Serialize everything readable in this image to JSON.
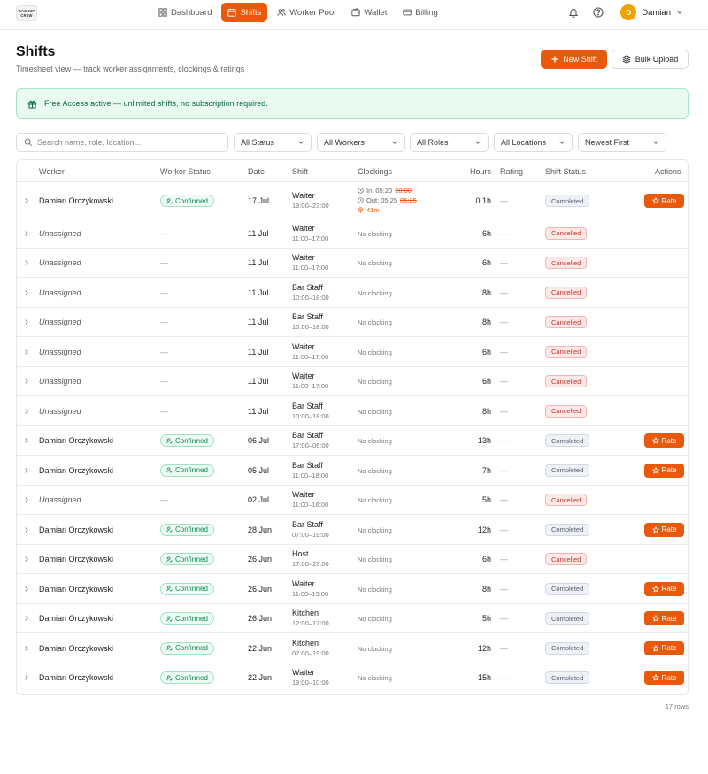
{
  "brand": {
    "logo_line1": "BACKUP",
    "logo_line2": "CREW"
  },
  "nav": {
    "items": [
      {
        "label": "Dashboard",
        "icon": "dashboard-icon",
        "active": false
      },
      {
        "label": "Shifts",
        "icon": "calendar-icon",
        "active": true
      },
      {
        "label": "Worker Pool",
        "icon": "users-icon",
        "active": false
      },
      {
        "label": "Wallet",
        "icon": "wallet-icon",
        "active": false
      },
      {
        "label": "Billing",
        "icon": "card-icon",
        "active": false
      }
    ],
    "user": {
      "initial": "D",
      "name": "Damian"
    }
  },
  "header": {
    "title": "Shifts",
    "subtitle": "Timesheet view — track worker assignments, clockings & ratings",
    "new_shift": "New Shift",
    "bulk_upload": "Bulk Upload"
  },
  "banner": {
    "text": "Free Access active — unlimited shifts, no subscription required."
  },
  "filters": {
    "search_placeholder": "Search name, role, location...",
    "status": "All Status",
    "workers": "All Workers",
    "roles": "All Roles",
    "locations": "All Locations",
    "sort": "Newest First"
  },
  "table": {
    "columns": [
      "Worker",
      "Worker Status",
      "Date",
      "Shift",
      "Clockings",
      "Hours",
      "Rating",
      "Shift Status",
      "Actions"
    ],
    "rows": [
      {
        "worker": "Damian Orczykowski",
        "assigned": true,
        "worker_status": "Confirmed",
        "date": "17 Jul",
        "role": "Waiter",
        "time": "19:00–23:00",
        "clocking": {
          "in": "In: 05:20",
          "in_sched": "20:00",
          "out": "Out: 05:25",
          "out_sched": "05:25",
          "late": "41m"
        },
        "hours": "0.1h",
        "rating": "—",
        "status": "Completed",
        "rate": "Rate"
      },
      {
        "worker": "Unassigned",
        "assigned": false,
        "worker_status": "—",
        "date": "11 Jul",
        "role": "Waiter",
        "time": "11:00–17:00",
        "clocking_text": "No clocking",
        "hours": "6h",
        "rating": "—",
        "status": "Cancelled"
      },
      {
        "worker": "Unassigned",
        "assigned": false,
        "worker_status": "—",
        "date": "11 Jul",
        "role": "Waiter",
        "time": "11:00–17:00",
        "clocking_text": "No clocking",
        "hours": "6h",
        "rating": "—",
        "status": "Cancelled"
      },
      {
        "worker": "Unassigned",
        "assigned": false,
        "worker_status": "—",
        "date": "11 Jul",
        "role": "Bar Staff",
        "time": "10:00–18:00",
        "clocking_text": "No clocking",
        "hours": "8h",
        "rating": "—",
        "status": "Cancelled"
      },
      {
        "worker": "Unassigned",
        "assigned": false,
        "worker_status": "—",
        "date": "11 Jul",
        "role": "Bar Staff",
        "time": "10:00–18:00",
        "clocking_text": "No clocking",
        "hours": "8h",
        "rating": "—",
        "status": "Cancelled"
      },
      {
        "worker": "Unassigned",
        "assigned": false,
        "worker_status": "—",
        "date": "11 Jul",
        "role": "Waiter",
        "time": "11:00–17:00",
        "clocking_text": "No clocking",
        "hours": "6h",
        "rating": "—",
        "status": "Cancelled"
      },
      {
        "worker": "Unassigned",
        "assigned": false,
        "worker_status": "—",
        "date": "11 Jul",
        "role": "Waiter",
        "time": "11:00–17:00",
        "clocking_text": "No clocking",
        "hours": "6h",
        "rating": "—",
        "status": "Cancelled"
      },
      {
        "worker": "Unassigned",
        "assigned": false,
        "worker_status": "—",
        "date": "11 Jul",
        "role": "Bar Staff",
        "time": "10:00–18:00",
        "clocking_text": "No clocking",
        "hours": "8h",
        "rating": "—",
        "status": "Cancelled"
      },
      {
        "worker": "Damian Orczykowski",
        "assigned": true,
        "worker_status": "Confirmed",
        "date": "06 Jul",
        "role": "Bar Staff",
        "time": "17:00–06:00",
        "clocking_text": "No clocking",
        "hours": "13h",
        "rating": "—",
        "status": "Completed",
        "rate": "Rate"
      },
      {
        "worker": "Damian Orczykowski",
        "assigned": true,
        "worker_status": "Confirmed",
        "date": "05 Jul",
        "role": "Bar Staff",
        "time": "11:00–18:00",
        "clocking_text": "No clocking",
        "hours": "7h",
        "rating": "—",
        "status": "Completed",
        "rate": "Rate"
      },
      {
        "worker": "Unassigned",
        "assigned": false,
        "worker_status": "—",
        "date": "02 Jul",
        "role": "Waiter",
        "time": "11:00–16:00",
        "clocking_text": "No clocking",
        "hours": "5h",
        "rating": "—",
        "status": "Cancelled"
      },
      {
        "worker": "Damian Orczykowski",
        "assigned": true,
        "worker_status": "Confirmed",
        "date": "28 Jun",
        "role": "Bar Staff",
        "time": "07:00–19:00",
        "clocking_text": "No clocking",
        "hours": "12h",
        "rating": "—",
        "status": "Completed",
        "rate": "Rate"
      },
      {
        "worker": "Damian Orczykowski",
        "assigned": true,
        "worker_status": "Confirmed",
        "date": "26 Jun",
        "role": "Host",
        "time": "17:00–23:00",
        "clocking_text": "No clocking",
        "hours": "6h",
        "rating": "—",
        "status": "Cancelled"
      },
      {
        "worker": "Damian Orczykowski",
        "assigned": true,
        "worker_status": "Confirmed",
        "date": "26 Jun",
        "role": "Waiter",
        "time": "11:00–19:00",
        "clocking_text": "No clocking",
        "hours": "8h",
        "rating": "—",
        "status": "Completed",
        "rate": "Rate"
      },
      {
        "worker": "Damian Orczykowski",
        "assigned": true,
        "worker_status": "Confirmed",
        "date": "26 Jun",
        "role": "Kitchen",
        "time": "12:00–17:00",
        "clocking_text": "No clocking",
        "hours": "5h",
        "rating": "—",
        "status": "Completed",
        "rate": "Rate"
      },
      {
        "worker": "Damian Orczykowski",
        "assigned": true,
        "worker_status": "Confirmed",
        "date": "22 Jun",
        "role": "Kitchen",
        "time": "07:00–19:00",
        "clocking_text": "No clocking",
        "hours": "12h",
        "rating": "—",
        "status": "Completed",
        "rate": "Rate"
      },
      {
        "worker": "Damian Orczykowski",
        "assigned": true,
        "worker_status": "Confirmed",
        "date": "22 Jun",
        "role": "Waiter",
        "time": "19:00–10:00",
        "clocking_text": "No clocking",
        "hours": "15h",
        "rating": "—",
        "status": "Completed",
        "rate": "Rate"
      }
    ],
    "row_count": "17 rows"
  },
  "colors": {
    "accent": "#e8590c",
    "success": "#0e8a52",
    "danger": "#c0392b"
  }
}
